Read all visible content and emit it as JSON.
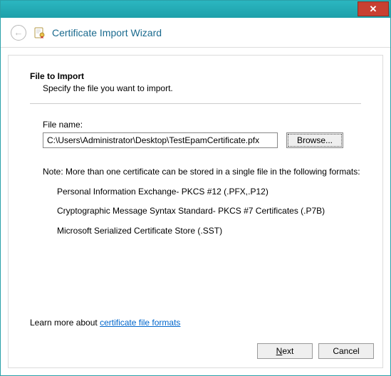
{
  "window": {
    "close_label": "✕"
  },
  "header": {
    "title": "Certificate Import Wizard"
  },
  "section": {
    "title": "File to Import",
    "subtitle": "Specify the file you want to import."
  },
  "file": {
    "label": "File name:",
    "value": "C:\\Users\\Administrator\\Desktop\\TestEpamCertificate.pfx",
    "browse_label": "Browse..."
  },
  "note": {
    "intro": "Note:  More than one certificate can be stored in a single file in the following formats:",
    "items": [
      "Personal Information Exchange- PKCS #12 (.PFX,.P12)",
      "Cryptographic Message Syntax Standard- PKCS #7 Certificates (.P7B)",
      "Microsoft Serialized Certificate Store (.SST)"
    ]
  },
  "learn": {
    "prefix": "Learn more about ",
    "link": "certificate file formats"
  },
  "buttons": {
    "next_prefix": "N",
    "next_rest": "ext",
    "cancel": "Cancel"
  }
}
